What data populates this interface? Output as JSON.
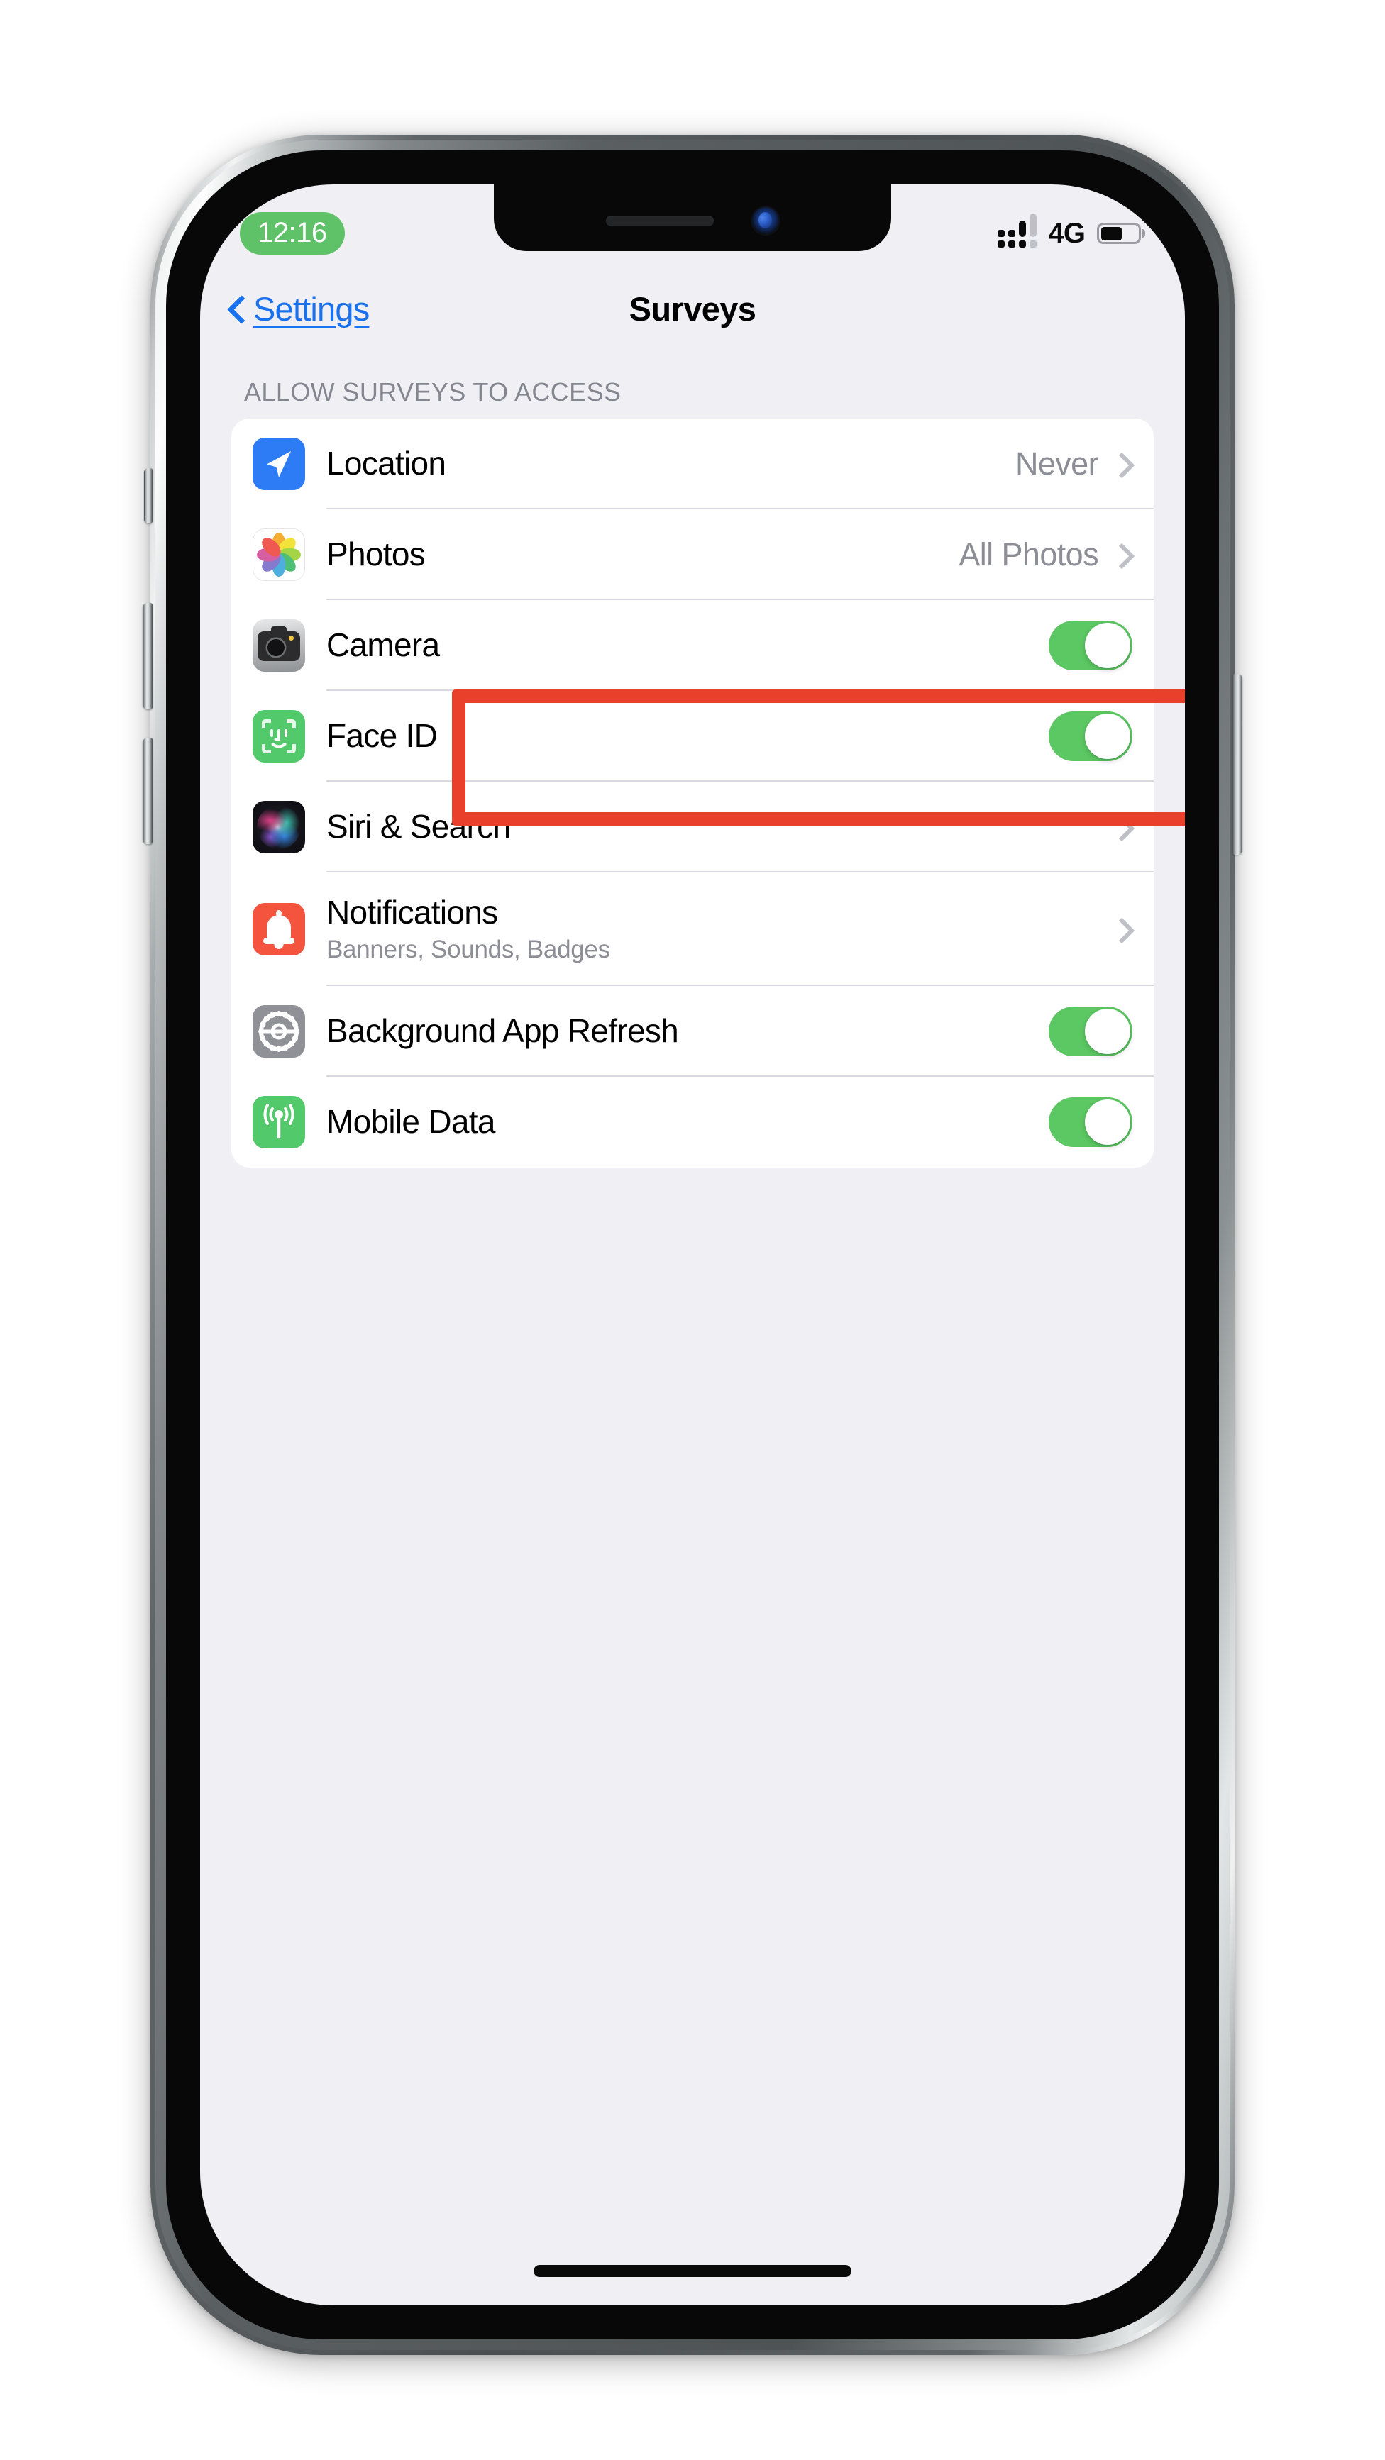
{
  "status_bar": {
    "time": "12:16",
    "carrier": "4G",
    "signal_icon": "signal-dots-icon",
    "battery_icon": "battery-icon",
    "battery_level_percent": 58
  },
  "nav": {
    "back_label": "Settings",
    "back_icon": "chevron-left-icon",
    "title": "Surveys"
  },
  "section": {
    "header": "ALLOW SURVEYS TO ACCESS"
  },
  "rows": [
    {
      "label": "Location",
      "value": "Never",
      "icon": "location-arrow-icon",
      "control": "disclosure",
      "highlighted": true
    },
    {
      "label": "Photos",
      "value": "All Photos",
      "icon": "photos-pinwheel-icon",
      "control": "disclosure",
      "highlighted": false
    },
    {
      "label": "Camera",
      "value": "",
      "icon": "camera-icon",
      "control": "toggle",
      "toggle_on": true,
      "highlighted": false
    },
    {
      "label": "Face ID",
      "value": "",
      "icon": "face-id-icon",
      "control": "toggle",
      "toggle_on": true,
      "highlighted": false
    },
    {
      "label": "Siri & Search",
      "value": "",
      "icon": "siri-orb-icon",
      "control": "disclosure",
      "highlighted": false
    },
    {
      "label": "Notifications",
      "sublabel": "Banners, Sounds, Badges",
      "value": "",
      "icon": "notifications-bell-icon",
      "control": "disclosure",
      "highlighted": false
    },
    {
      "label": "Background App Refresh",
      "value": "",
      "icon": "gear-icon",
      "control": "toggle",
      "toggle_on": true,
      "highlighted": false
    },
    {
      "label": "Mobile Data",
      "value": "",
      "icon": "antenna-icon",
      "control": "toggle",
      "toggle_on": true,
      "highlighted": false
    }
  ],
  "colors": {
    "accent_blue": "#1b72ef",
    "toggle_green": "#5cc863",
    "highlight_red": "#e8402a",
    "screen_bg": "#f0f0f4",
    "card_bg": "#ffffff",
    "secondary_text": "#8d8d96",
    "time_pill_green": "#60c268"
  }
}
